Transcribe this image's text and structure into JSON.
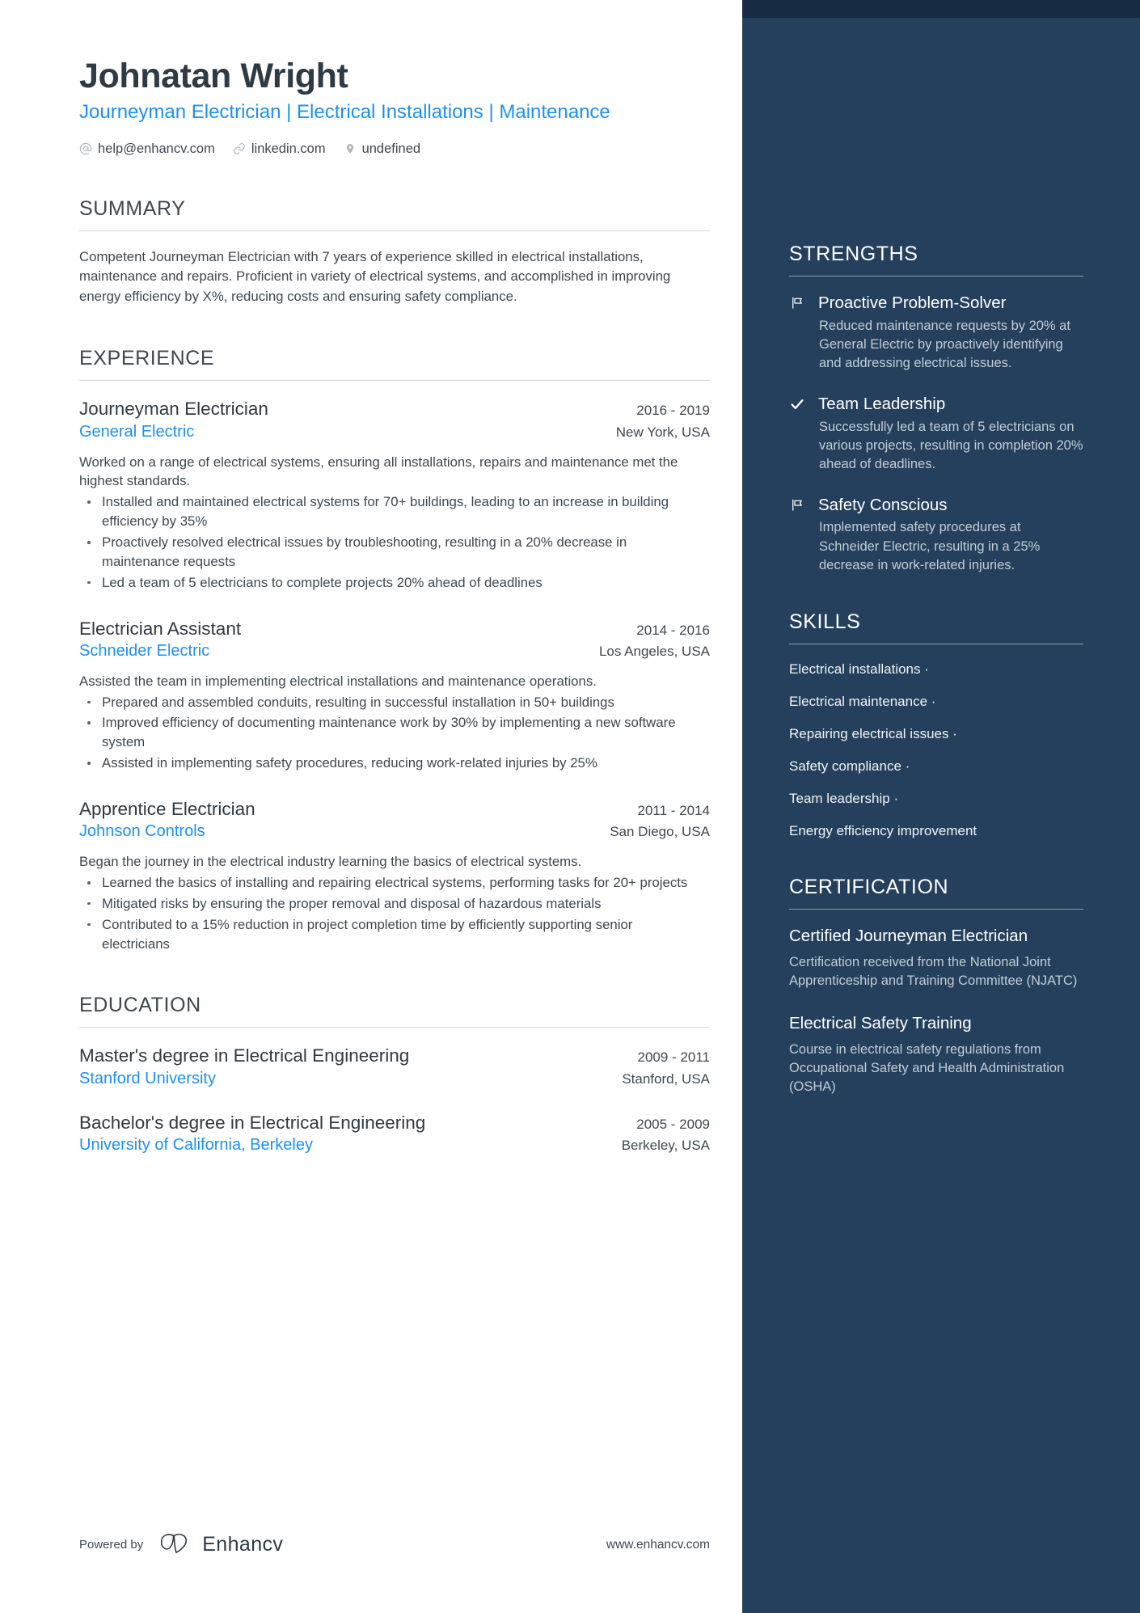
{
  "header": {
    "name": "Johnatan Wright",
    "headline": "Journeyman Electrician | Electrical Installations | Maintenance",
    "contacts": [
      {
        "icon": "at-sign-icon",
        "text": "help@enhancv.com"
      },
      {
        "icon": "link-icon",
        "text": "linkedin.com"
      },
      {
        "icon": "location-pin-icon",
        "text": "undefined"
      }
    ]
  },
  "summary": {
    "title": "SUMMARY",
    "text": "Competent Journeyman Electrician with 7 years of experience skilled in electrical installations, maintenance and repairs. Proficient in variety of electrical systems, and accomplished in improving energy efficiency by X%, reducing costs and ensuring safety compliance."
  },
  "experience": {
    "title": "EXPERIENCE",
    "entries": [
      {
        "role": "Journeyman Electrician",
        "company": "General Electric",
        "dates": "2016 - 2019",
        "location": "New York, USA",
        "description": "Worked on a range of electrical systems, ensuring all installations, repairs and maintenance met the highest standards.",
        "bullets": [
          "Installed and maintained electrical systems for 70+ buildings, leading to an increase in building efficiency by 35%",
          "Proactively resolved electrical issues by troubleshooting, resulting in a 20% decrease in maintenance requests",
          "Led a team of 5 electricians to complete projects 20% ahead of deadlines"
        ]
      },
      {
        "role": "Electrician Assistant",
        "company": "Schneider Electric",
        "dates": "2014 - 2016",
        "location": "Los Angeles, USA",
        "description": "Assisted the team in implementing electrical installations and maintenance operations.",
        "bullets": [
          "Prepared and assembled conduits, resulting in successful installation in 50+ buildings",
          "Improved efficiency of documenting maintenance work by 30% by implementing a new software system",
          "Assisted in implementing safety procedures, reducing work-related injuries by 25%"
        ]
      },
      {
        "role": "Apprentice Electrician",
        "company": "Johnson Controls",
        "dates": "2011 - 2014",
        "location": "San Diego, USA",
        "description": "Began the journey in the electrical industry learning the basics of electrical systems.",
        "bullets": [
          "Learned the basics of installing and repairing electrical systems, performing tasks for 20+ projects",
          "Mitigated risks by ensuring the proper removal and disposal of hazardous materials",
          "Contributed to a 15% reduction in project completion time by efficiently supporting senior electricians"
        ]
      }
    ]
  },
  "education": {
    "title": "EDUCATION",
    "entries": [
      {
        "degree": "Master's degree in Electrical Engineering",
        "school": "Stanford University",
        "dates": "2009 - 2011",
        "location": "Stanford, USA"
      },
      {
        "degree": "Bachelor's degree in Electrical Engineering",
        "school": "University of California, Berkeley",
        "dates": "2005 - 2009",
        "location": "Berkeley, USA"
      }
    ]
  },
  "strengths": {
    "title": "STRENGTHS",
    "items": [
      {
        "icon": "flag-icon",
        "heading": "Proactive Problem-Solver",
        "body": "Reduced maintenance requests by 20% at General Electric by proactively identifying and addressing electrical issues."
      },
      {
        "icon": "check-icon",
        "heading": "Team Leadership",
        "body": "Successfully led a team of 5 electricians on various projects, resulting in completion 20% ahead of deadlines."
      },
      {
        "icon": "flag-icon",
        "heading": "Safety Conscious",
        "body": "Implemented safety procedures at Schneider Electric, resulting in a 25% decrease in work-related injuries."
      }
    ]
  },
  "skills": {
    "title": "SKILLS",
    "items": [
      "Electrical installations ·",
      "Electrical maintenance ·",
      "Repairing electrical issues ·",
      "Safety compliance ·",
      "Team leadership ·",
      "Energy efficiency improvement"
    ]
  },
  "certification": {
    "title": "CERTIFICATION",
    "items": [
      {
        "name": "Certified Journeyman Electrician",
        "description": "Certification received from the National Joint Apprenticeship and Training Committee (NJATC)"
      },
      {
        "name": "Electrical Safety Training",
        "description": "Course in electrical safety regulations from Occupational Safety and Health Administration (OSHA)"
      }
    ]
  },
  "footer": {
    "powered_by": "Powered by",
    "brand": "Enhancv",
    "website": "www.enhancv.com"
  },
  "colors": {
    "sidebar_bg": "#25405c",
    "sidebar_top_band": "#172c42",
    "accent_blue": "#1e90ef",
    "text_dark": "#3d4852"
  }
}
